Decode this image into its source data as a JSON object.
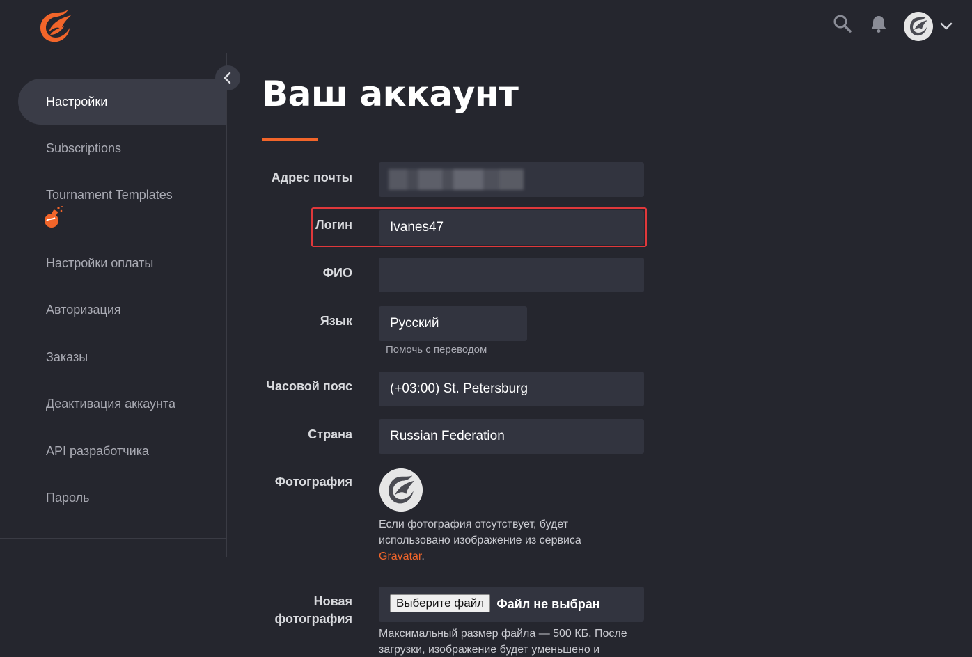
{
  "header": {
    "icons": [
      "search-icon",
      "bell-icon",
      "avatar",
      "chevron-down-icon"
    ]
  },
  "sidebar": {
    "items": [
      {
        "label": "Настройки",
        "active": true
      },
      {
        "label": "Subscriptions"
      },
      {
        "label": "Tournament Templates",
        "icon": "potion-icon"
      },
      {
        "label": "Настройки оплаты"
      },
      {
        "label": "Авторизация"
      },
      {
        "label": "Заказы"
      },
      {
        "label": "Деактивация аккаунта"
      },
      {
        "label": "API разработчика"
      },
      {
        "label": "Пароль"
      }
    ]
  },
  "main": {
    "title": "Ваш аккаунт",
    "fields": {
      "email": {
        "label": "Адрес почты",
        "value": ""
      },
      "login": {
        "label": "Логин",
        "value": "Ivanes47"
      },
      "fio": {
        "label": "ФИО",
        "value": ""
      },
      "language": {
        "label": "Язык",
        "value": "Русский",
        "hint": "Помочь с переводом"
      },
      "timezone": {
        "label": "Часовой пояс",
        "value": "(+03:00) St. Petersburg"
      },
      "country": {
        "label": "Страна",
        "value": "Russian Federation"
      },
      "photo": {
        "label": "Фотография",
        "desc_1": "Если фотография отсутствует, будет",
        "desc_2": "использовано изображение из сервиса",
        "link": "Gravatar",
        "after_link": "."
      },
      "new_photo": {
        "label_1": "Новая",
        "label_2": "фотография",
        "button": "Выберите файл",
        "status": "Файл не выбран",
        "desc_1": "Максимальный размер файла — 500 КБ. После",
        "desc_2": "загрузки, изображение будет уменьшено и"
      }
    }
  },
  "colors": {
    "accent": "#f2652a",
    "background": "#25262e",
    "field": "#32343f",
    "highlight": "#e0383b"
  }
}
